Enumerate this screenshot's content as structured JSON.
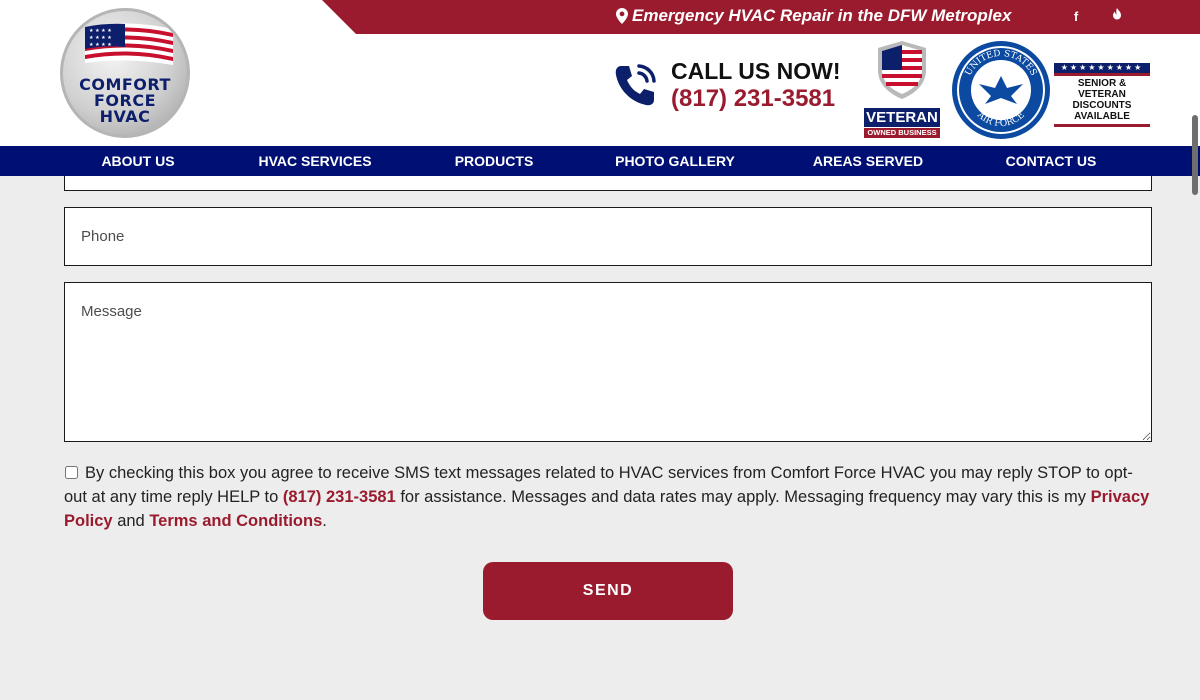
{
  "colors": {
    "brand_red": "#9a1b2e",
    "nav_blue": "#000f73",
    "page_bg": "#ededed"
  },
  "header": {
    "emergency_text": "Emergency HVAC Repair in the DFW Metroplex",
    "icons": {
      "location": "map-pin-icon",
      "facebook": "facebook-icon",
      "yelp": "yelp-icon"
    },
    "logo": {
      "line1": "COMFORT",
      "line2": "FORCE",
      "line3": "HVAC"
    },
    "call": {
      "title": "CALL US NOW!",
      "number": "(817) 231-3581",
      "icon": "phone-icon"
    },
    "badges": {
      "veteran_label": "VETERAN",
      "veteran_sub": "OWNED BUSINESS",
      "air_force_text_top": "UNITED STATES",
      "air_force_text_bottom": "AIR FORCE",
      "senior_stars": "★★★★★★★★★",
      "senior_line1": "SENIOR & VETERAN",
      "senior_line2": "DISCOUNTS AVAILABLE"
    }
  },
  "nav": {
    "items": [
      {
        "label": "About Us"
      },
      {
        "label": "HVAC Services"
      },
      {
        "label": "Products"
      },
      {
        "label": "Photo Gallery"
      },
      {
        "label": "Areas Served"
      },
      {
        "label": "Contact Us"
      }
    ]
  },
  "form": {
    "phone_placeholder": "Phone",
    "message_placeholder": "Message",
    "consent": {
      "part1": "By checking this box you agree to receive SMS text messages related to HVAC services from Comfort Force HVAC you may reply STOP to opt-out at any time reply HELP to ",
      "phone_link": "(817) 231-3581",
      "part2": " for assistance. Messages and data rates may apply. Messaging frequency may vary this is my ",
      "privacy_link": "Privacy Policy",
      "part3": " and ",
      "terms_link": "Terms and Conditions",
      "part4": "."
    },
    "send_label": "SEND"
  }
}
